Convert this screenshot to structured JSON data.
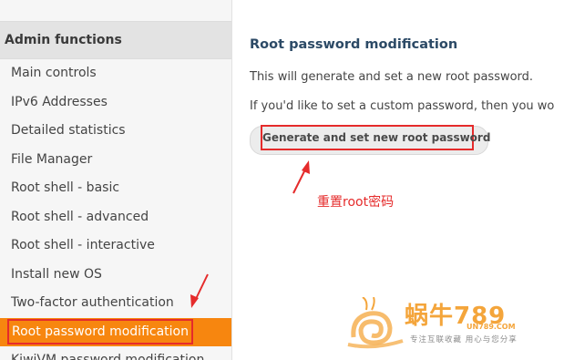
{
  "sidebar": {
    "header": "Admin functions",
    "items": [
      {
        "label": "Main controls"
      },
      {
        "label": "IPv6 Addresses"
      },
      {
        "label": "Detailed statistics"
      },
      {
        "label": "File Manager"
      },
      {
        "label": "Root shell - basic"
      },
      {
        "label": "Root shell - advanced"
      },
      {
        "label": "Root shell - interactive"
      },
      {
        "label": "Install new OS"
      },
      {
        "label": "Two-factor authentication"
      },
      {
        "label": "Root password modification",
        "active": true
      },
      {
        "label": "KiwiVM password modification"
      }
    ]
  },
  "main": {
    "title": "Root password modification",
    "paragraph1": "This will generate and set a new root password.",
    "paragraph2": "If you'd like to set a custom password, then you wo",
    "generate_button": "Generate and set new root password"
  },
  "annotation": {
    "text": "重置root密码",
    "color": "#e52b2b"
  },
  "watermark": {
    "brand": "蜗牛789",
    "domain": "UN789.COM",
    "slogan": "专注互联收藏  用心与您分享"
  },
  "colors": {
    "accent": "#f7860f",
    "highlight": "#e52b2b",
    "title": "#2c4a66"
  }
}
